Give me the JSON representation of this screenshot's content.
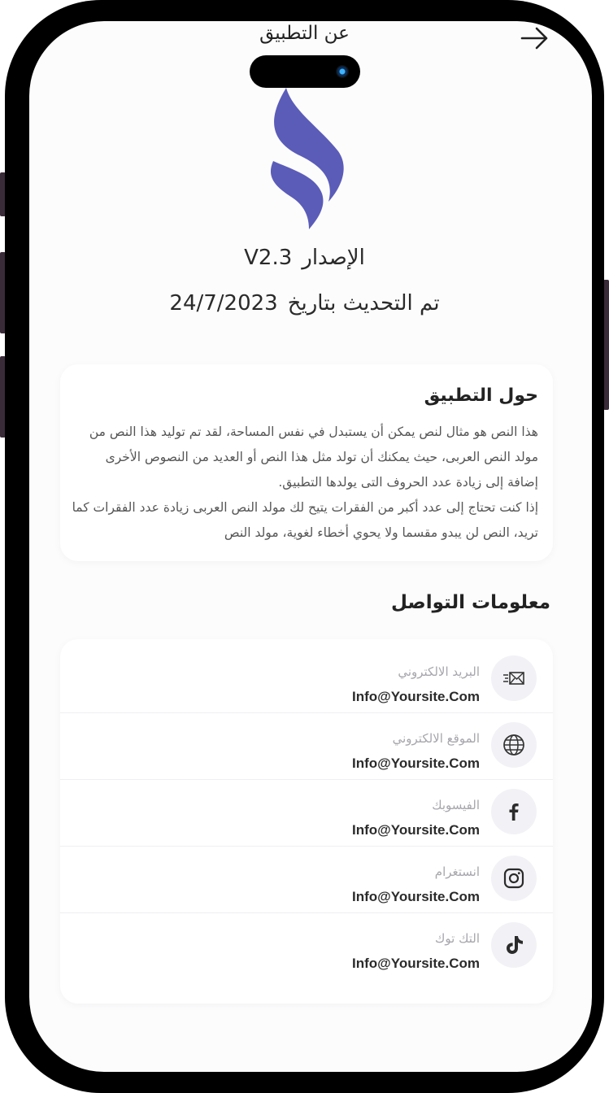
{
  "header": {
    "title": "عن التطبيق"
  },
  "app_info": {
    "version_label": "الإصدار",
    "version_value": "V2.3",
    "update_label": "تم التحديث بتاريخ",
    "update_date": "24/7/2023"
  },
  "about": {
    "heading": "حول التطبيق",
    "paragraph_1": "هذا النص هو مثال لنص يمكن أن يستبدل في نفس المساحة، لقد تم توليد هذا النص من مولد النص العربى، حيث يمكنك أن تولد مثل هذا النص أو العديد من النصوص الأخرى إضافة إلى زيادة عدد الحروف التى يولدها التطبيق.",
    "paragraph_2": "إذا كنت تحتاج إلى عدد أكبر من الفقرات يتيح لك مولد النص العربى زيادة عدد الفقرات كما تريد، النص لن يبدو مقسما ولا يحوي أخطاء لغوية، مولد النص"
  },
  "contact": {
    "heading": "معلومات التواصل",
    "items": [
      {
        "label": "البريد الالكتروني",
        "value": "Info@Yoursite.Com",
        "icon": "email-icon"
      },
      {
        "label": "الموقع الالكتروني",
        "value": "Info@Yoursite.Com",
        "icon": "globe-icon"
      },
      {
        "label": "الفيسوبك",
        "value": "Info@Yoursite.Com",
        "icon": "facebook-icon"
      },
      {
        "label": "انستغرام",
        "value": "Info@Yoursite.Com",
        "icon": "instagram-icon"
      },
      {
        "label": "التك توك",
        "value": "Info@Yoursite.Com",
        "icon": "tiktok-icon"
      }
    ]
  },
  "colors": {
    "brand": "#5b5cb8",
    "background": "#fcfcfd",
    "card": "#ffffff",
    "icon_circle": "#f2f2f6"
  }
}
